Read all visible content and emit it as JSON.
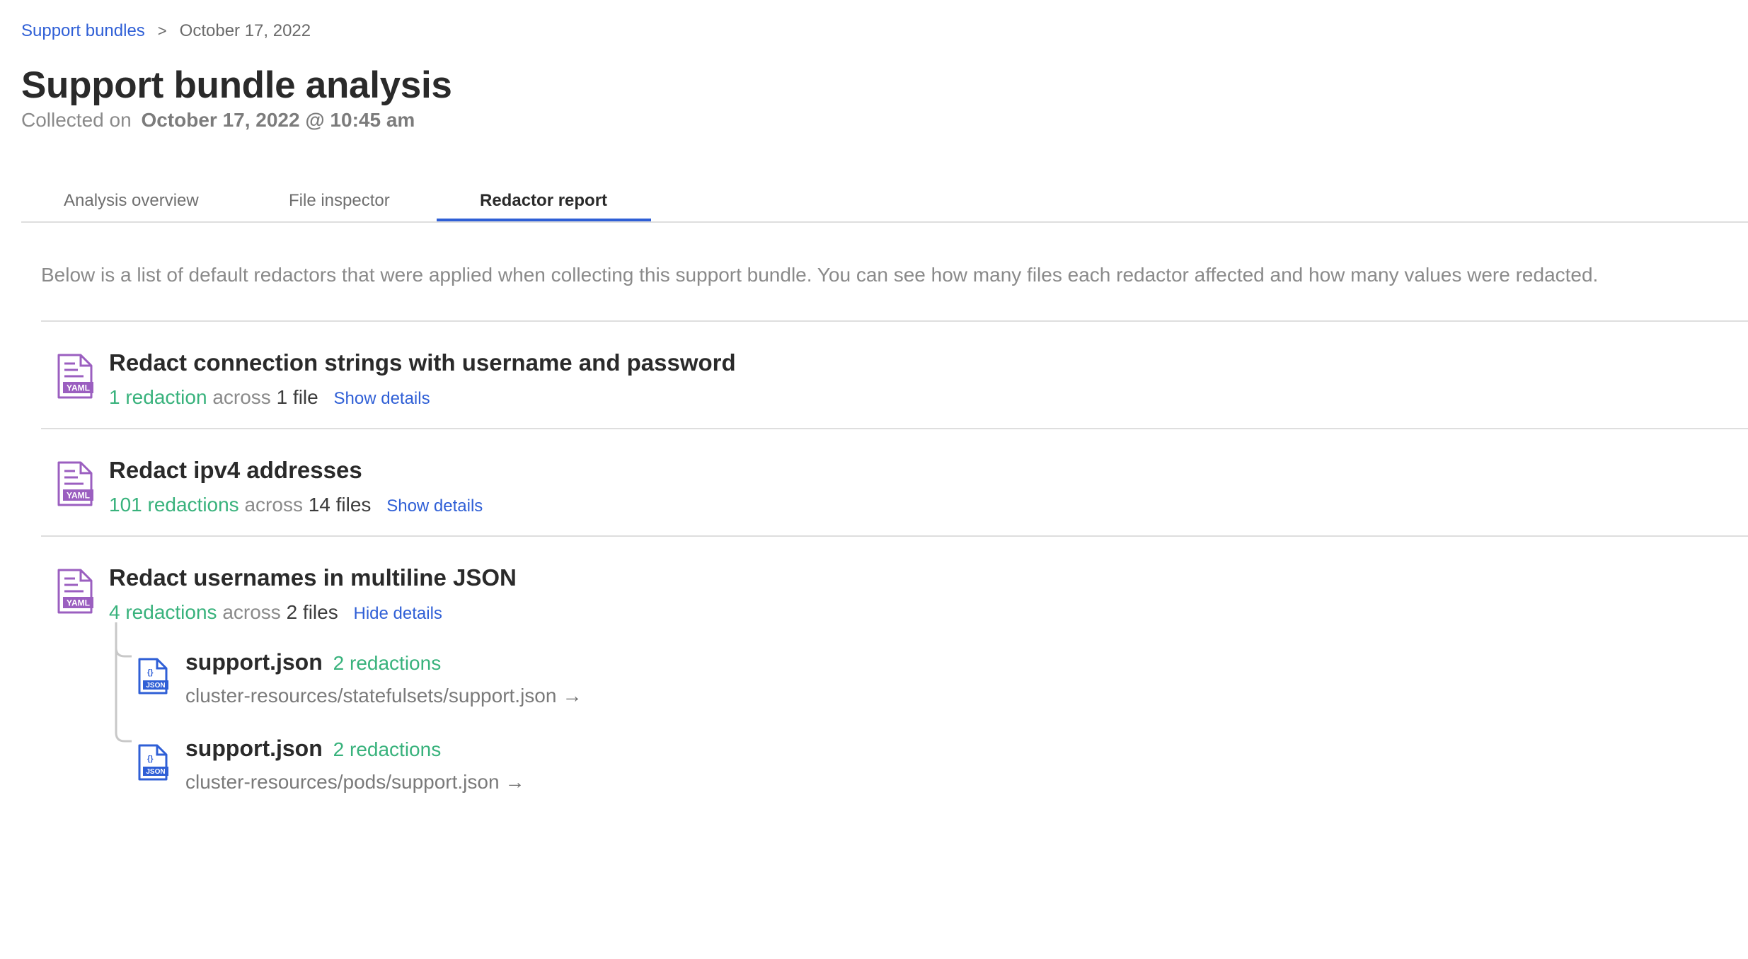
{
  "breadcrumb": {
    "root": "Support bundles",
    "separator": ">",
    "current": "October 17, 2022"
  },
  "header": {
    "title": "Support bundle analysis",
    "collected_label": "Collected on",
    "collected_date": "October 17, 2022 @ 10:45 am"
  },
  "tabs": [
    {
      "label": "Analysis overview",
      "active": false
    },
    {
      "label": "File inspector",
      "active": false
    },
    {
      "label": "Redactor report",
      "active": true
    }
  ],
  "intro": "Below is a list of default redactors that were applied when collecting this support bundle. You can see how many files each redactor affected and how many values were redacted.",
  "redactors": [
    {
      "icon": "yaml-file-icon",
      "title": "Redact connection strings with username and password",
      "redactions": "1 redaction",
      "across": "across",
      "files": "1 file",
      "toggle": "Show details"
    },
    {
      "icon": "yaml-file-icon",
      "title": "Redact ipv4 addresses",
      "redactions": "101 redactions",
      "across": "across",
      "files": "14 files",
      "toggle": "Show details"
    },
    {
      "icon": "yaml-file-icon",
      "title": "Redact usernames in multiline JSON",
      "redactions": "4 redactions",
      "across": "across",
      "files": "2 files",
      "toggle": "Hide details",
      "details": [
        {
          "icon": "json-file-icon",
          "name": "support.json",
          "redactions": "2 redactions",
          "path": "cluster-resources/statefulsets/support.json"
        },
        {
          "icon": "json-file-icon",
          "name": "support.json",
          "redactions": "2 redactions",
          "path": "cluster-resources/pods/support.json"
        }
      ]
    }
  ],
  "icon_labels": {
    "yaml": "YAML",
    "json": "JSON",
    "json_braces": "{}",
    "arrow": "→"
  },
  "colors": {
    "accent": "#2f5fd6",
    "success": "#38b27c",
    "yaml_purple": "#9b5fc0"
  }
}
